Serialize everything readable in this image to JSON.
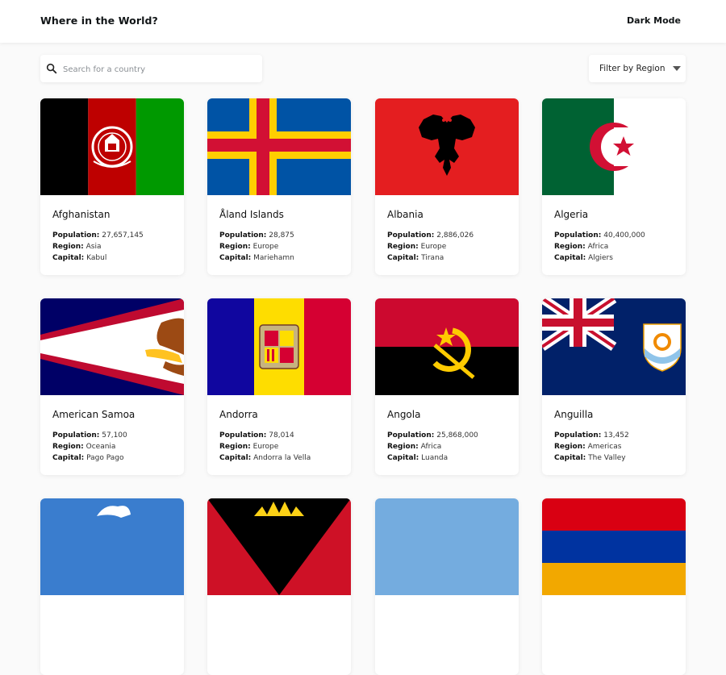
{
  "header": {
    "title": "Where in the World?",
    "mode_toggle": "Dark Mode"
  },
  "search": {
    "placeholder": "Search for a country",
    "value": ""
  },
  "filter": {
    "label": "Filter by Region"
  },
  "labels": {
    "population": "Population:",
    "region": "Region:",
    "capital": "Capital:"
  },
  "countries": [
    {
      "name": "Afghanistan",
      "population": "27,657,145",
      "region": "Asia",
      "capital": "Kabul"
    },
    {
      "name": "Åland Islands",
      "population": "28,875",
      "region": "Europe",
      "capital": "Mariehamn"
    },
    {
      "name": "Albania",
      "population": "2,886,026",
      "region": "Europe",
      "capital": "Tirana"
    },
    {
      "name": "Algeria",
      "population": "40,400,000",
      "region": "Africa",
      "capital": "Algiers"
    },
    {
      "name": "American Samoa",
      "population": "57,100",
      "region": "Oceania",
      "capital": "Pago Pago"
    },
    {
      "name": "Andorra",
      "population": "78,014",
      "region": "Europe",
      "capital": "Andorra la Vella"
    },
    {
      "name": "Angola",
      "population": "25,868,000",
      "region": "Africa",
      "capital": "Luanda"
    },
    {
      "name": "Anguilla",
      "population": "13,452",
      "region": "Americas",
      "capital": "The Valley"
    }
  ],
  "colors": {
    "background": "#fafafa",
    "card": "#ffffff",
    "text": "#111517"
  }
}
